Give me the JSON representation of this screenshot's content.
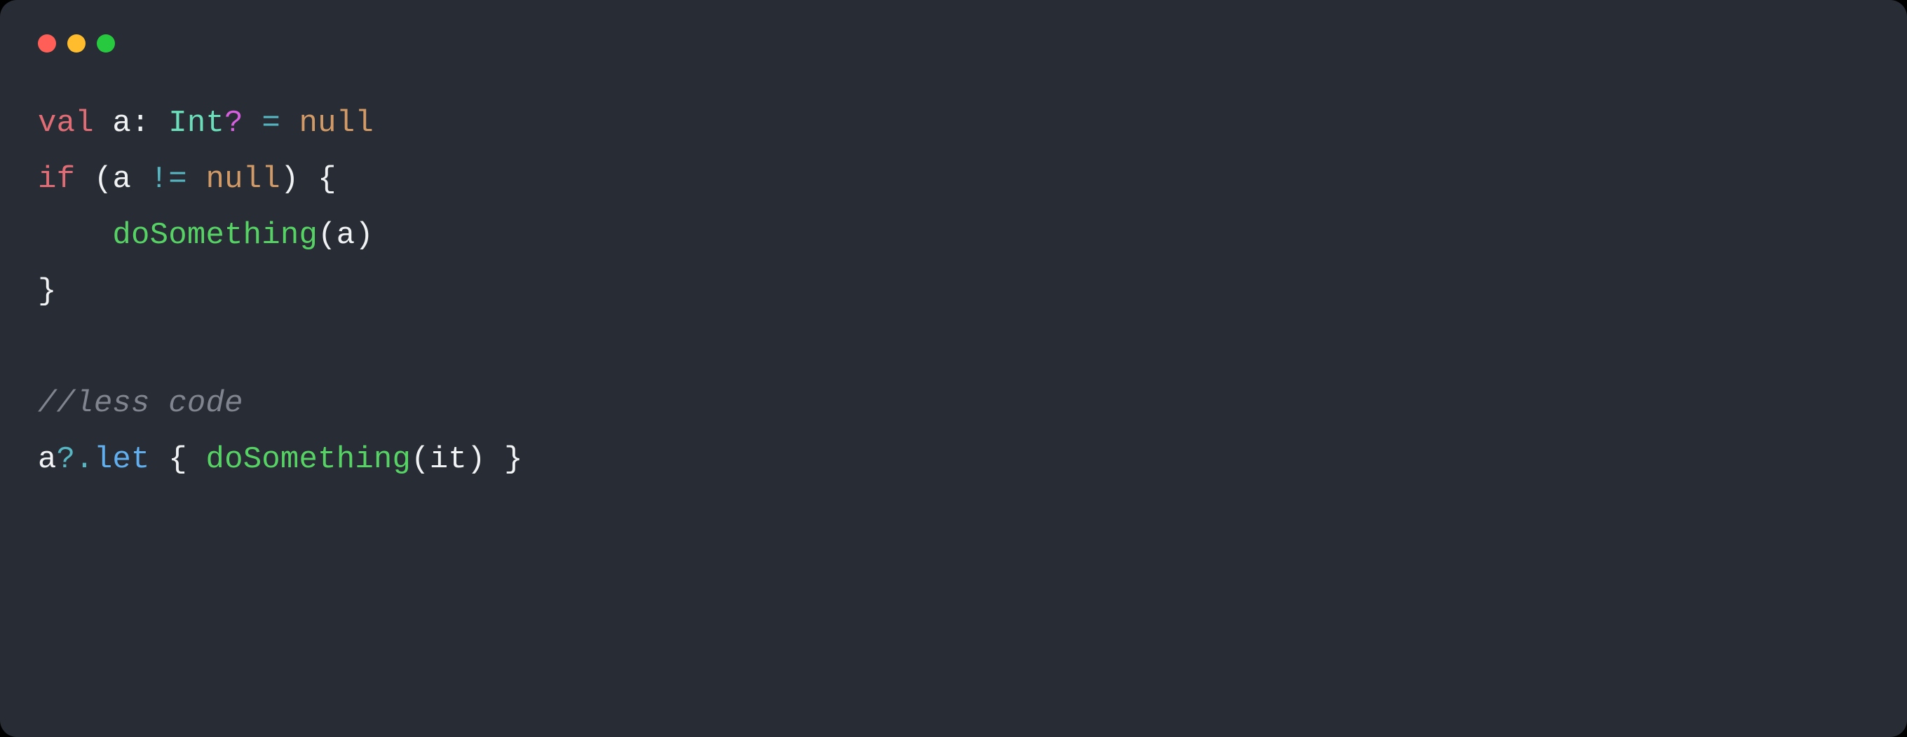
{
  "window": {
    "traffic_lights": {
      "red": "#ff5f56",
      "yellow": "#ffbd2e",
      "green": "#27c93f"
    }
  },
  "code": {
    "lines": [
      {
        "tokens": [
          {
            "cls": "tok-kw",
            "text": "val"
          },
          {
            "cls": "tok-ident",
            "text": " a"
          },
          {
            "cls": "tok-punct",
            "text": ": "
          },
          {
            "cls": "tok-type",
            "text": "Int"
          },
          {
            "cls": "tok-typeop",
            "text": "?"
          },
          {
            "cls": "tok-ident",
            "text": " "
          },
          {
            "cls": "tok-op",
            "text": "="
          },
          {
            "cls": "tok-ident",
            "text": " "
          },
          {
            "cls": "tok-null",
            "text": "null"
          }
        ]
      },
      {
        "tokens": [
          {
            "cls": "tok-kw",
            "text": "if"
          },
          {
            "cls": "tok-ident",
            "text": " "
          },
          {
            "cls": "tok-punct",
            "text": "("
          },
          {
            "cls": "tok-ident",
            "text": "a "
          },
          {
            "cls": "tok-op",
            "text": "!="
          },
          {
            "cls": "tok-ident",
            "text": " "
          },
          {
            "cls": "tok-null",
            "text": "null"
          },
          {
            "cls": "tok-punct",
            "text": ") {"
          }
        ]
      },
      {
        "tokens": [
          {
            "cls": "tok-ident",
            "text": "    "
          },
          {
            "cls": "tok-call",
            "text": "doSomething"
          },
          {
            "cls": "tok-punct",
            "text": "("
          },
          {
            "cls": "tok-ident",
            "text": "a"
          },
          {
            "cls": "tok-punct",
            "text": ")"
          }
        ]
      },
      {
        "tokens": [
          {
            "cls": "tok-punct",
            "text": "}"
          }
        ]
      },
      {
        "tokens": [
          {
            "cls": "tok-ident",
            "text": ""
          }
        ]
      },
      {
        "tokens": [
          {
            "cls": "tok-comment",
            "text": "//less code"
          }
        ]
      },
      {
        "tokens": [
          {
            "cls": "tok-ident",
            "text": "a"
          },
          {
            "cls": "tok-op",
            "text": "?."
          },
          {
            "cls": "tok-let",
            "text": "let"
          },
          {
            "cls": "tok-ident",
            "text": " "
          },
          {
            "cls": "tok-punct",
            "text": "{ "
          },
          {
            "cls": "tok-call",
            "text": "doSomething"
          },
          {
            "cls": "tok-punct",
            "text": "("
          },
          {
            "cls": "tok-ident",
            "text": "it"
          },
          {
            "cls": "tok-punct",
            "text": ") }"
          }
        ]
      }
    ]
  }
}
